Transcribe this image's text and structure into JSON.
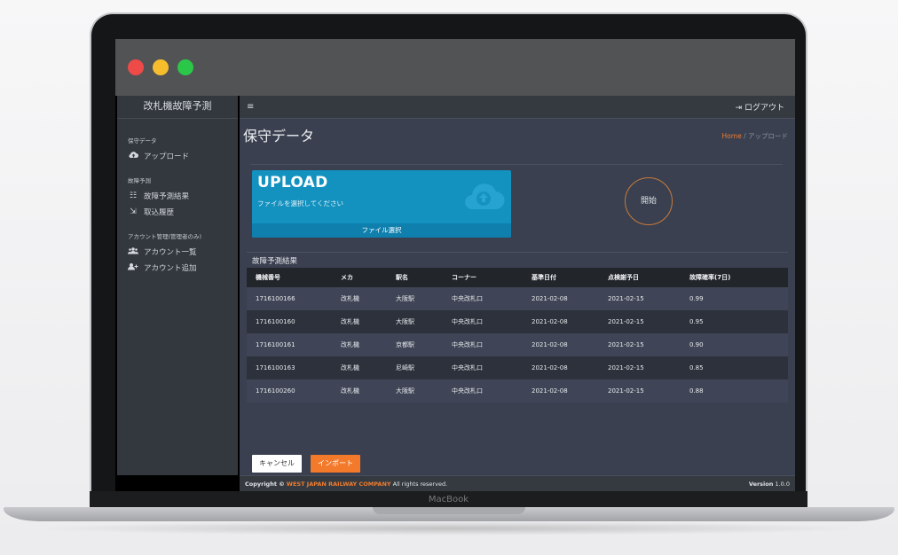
{
  "device": {
    "label": "MacBook"
  },
  "sidebar": {
    "brand": "改札機故障予測",
    "sections": [
      {
        "header": "保守データ",
        "items": [
          {
            "icon": "cloud-upload-icon",
            "label": "アップロード"
          }
        ]
      },
      {
        "header": "故障予測",
        "items": [
          {
            "icon": "list-icon",
            "label": "故障予測結果"
          },
          {
            "icon": "import-history-icon",
            "label": "取込履歴"
          }
        ]
      },
      {
        "header": "アカウント管理(管理者のみ)",
        "items": [
          {
            "icon": "users-icon",
            "label": "アカウント一覧"
          },
          {
            "icon": "user-plus-icon",
            "label": "アカウント追加"
          }
        ]
      }
    ]
  },
  "topbar": {
    "menu_glyph": "≡",
    "logout_glyph": "⇥",
    "logout_label": "ログアウト"
  },
  "page": {
    "title": "保守データ",
    "breadcrumb_home": "Home",
    "breadcrumb_sep": "/",
    "breadcrumb_current": "アップロード"
  },
  "upload": {
    "title": "UPLOAD",
    "subtitle": "ファイルを選択してください",
    "button": "ファイル選択",
    "icon": "cloud-upload-icon",
    "start_label": "開始"
  },
  "results": {
    "title": "故障予測結果",
    "columns": [
      "機械番号",
      "メカ",
      "駅名",
      "コーナー",
      "基準日付",
      "点検謝予日",
      "故障確率(7日)"
    ],
    "rows": [
      [
        "1716100166",
        "改札機",
        "大阪駅",
        "中央改札口",
        "2021-02-08",
        "2021-02-15",
        "0.99"
      ],
      [
        "1716100160",
        "改札機",
        "大阪駅",
        "中央改札口",
        "2021-02-08",
        "2021-02-15",
        "0.95"
      ],
      [
        "1716100161",
        "改札機",
        "京都駅",
        "中央改札口",
        "2021-02-08",
        "2021-02-15",
        "0.90"
      ],
      [
        "1716100163",
        "改札機",
        "尼崎駅",
        "中央改札口",
        "2021-02-08",
        "2021-02-15",
        "0.85"
      ],
      [
        "1716100260",
        "改札機",
        "大阪駅",
        "中央改札口",
        "2021-02-08",
        "2021-02-15",
        "0.88"
      ]
    ]
  },
  "actions": {
    "cancel": "キャンセル",
    "import": "インポート"
  },
  "footer": {
    "prefix": "Copyright ©",
    "company": "WEST JAPAN RAILWAY COMPANY",
    "suffix": "All rights reserved.",
    "version_label": "Version",
    "version": "1.0.0"
  },
  "colors": {
    "accent": "#f37a2a",
    "upload": "#1391bf",
    "sidebar": "#32383e",
    "content": "#3a4050"
  }
}
